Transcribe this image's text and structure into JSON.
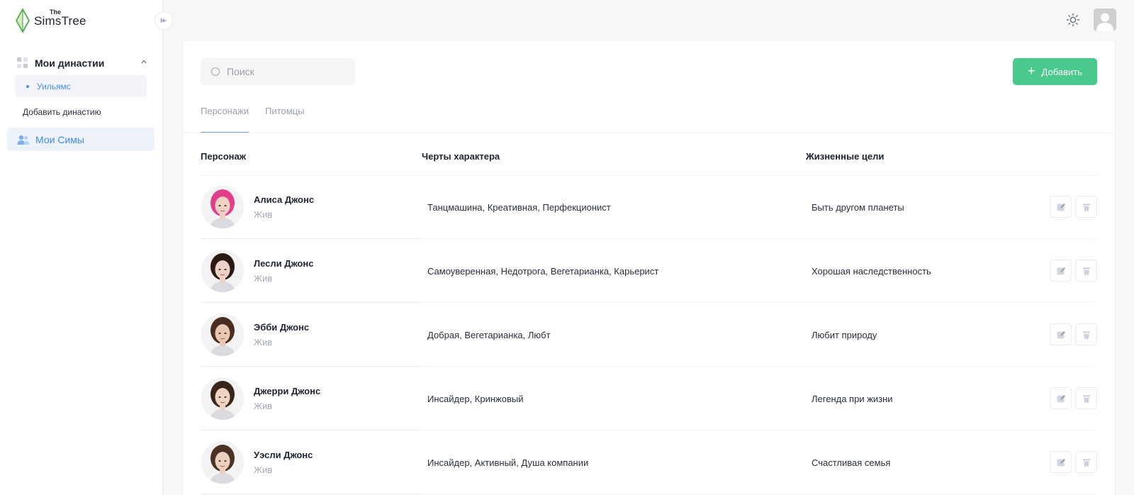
{
  "brand": {
    "the": "The",
    "name": "SimsTree"
  },
  "sidebar": {
    "dynasties_label": "Мои династии",
    "dynasty_items": [
      {
        "label": "Уильямс"
      }
    ],
    "add_dynasty": "Добавить династию",
    "my_sims": "Мои Симы"
  },
  "toolbar": {
    "search_placeholder": "Поиск",
    "add_label": "Добавить"
  },
  "tabs": [
    {
      "label": "Персонажи",
      "active": true
    },
    {
      "label": "Питомцы",
      "active": false
    }
  ],
  "table": {
    "headers": {
      "character": "Персонаж",
      "traits": "Черты характера",
      "goals": "Жизненные цели"
    },
    "rows": [
      {
        "name": "Алиса Джонс",
        "status": "Жив",
        "traits": "Танцмашина, Креативная, Перфекционист",
        "goal": "Быть другом планеты",
        "hair": "#e13d8a",
        "skin": "#f0d2c4"
      },
      {
        "name": "Лесли Джонс",
        "status": "Жив",
        "traits": "Самоуверенная, Недотрога, Вегетарианка, Карьерист",
        "goal": "Хорошая наследственность",
        "hair": "#2a1a14",
        "skin": "#ecd1c6"
      },
      {
        "name": "Эбби Джонс",
        "status": "Жив",
        "traits": "Добрая, Вегетарианка, Любт",
        "goal": "Любит природу",
        "hair": "#4a2d1e",
        "skin": "#e9c7b3"
      },
      {
        "name": "Джерри Джонс",
        "status": "Жив",
        "traits": "Инсайдер, Кринжовый",
        "goal": "Легенда при жизни",
        "hair": "#3a251b",
        "skin": "#efd3c3"
      },
      {
        "name": "Уэсли Джонс",
        "status": "Жив",
        "traits": "Инсайдер, Активный, Душа компании",
        "goal": "Счастливая семья",
        "hair": "#4a3324",
        "skin": "#ebcfbf"
      }
    ]
  },
  "colors": {
    "accent_green": "#49c98b",
    "accent_blue": "#3d8be3",
    "muted": "#a4a8b3"
  }
}
